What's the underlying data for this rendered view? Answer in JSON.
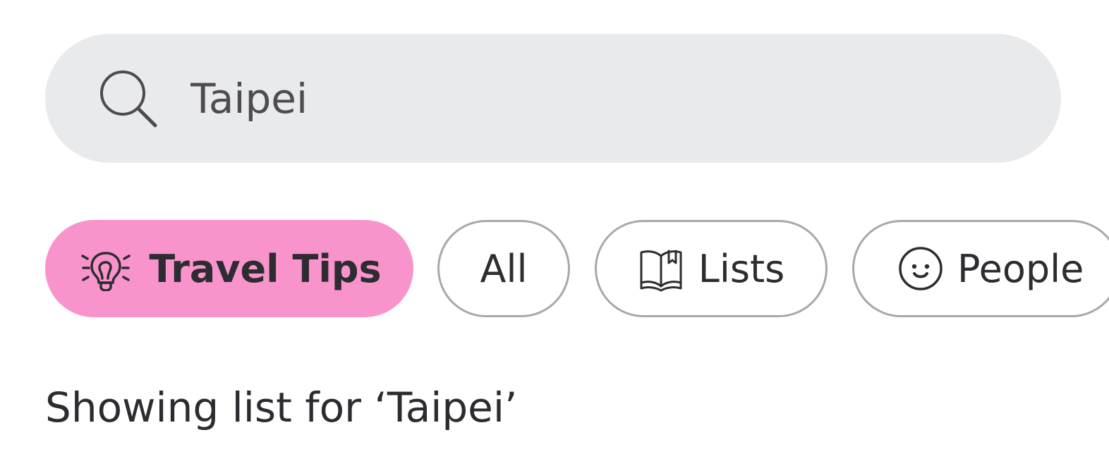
{
  "search": {
    "value": "Taipei",
    "icon": "search-icon"
  },
  "filters": [
    {
      "label": "Travel Tips",
      "icon": "lightbulb-icon",
      "selected": true
    },
    {
      "label": "All",
      "icon": "",
      "selected": false
    },
    {
      "label": "Lists",
      "icon": "open-book-icon",
      "selected": false
    },
    {
      "label": "People",
      "icon": "smiley-face-icon",
      "selected": false
    }
  ],
  "results": {
    "label": "Showing list for ‘Taipei’"
  },
  "colors": {
    "active_chip": "#f993cb",
    "search_bg": "#e9eaec",
    "chip_border": "#a8a7ab",
    "text": "#2d2c31"
  }
}
